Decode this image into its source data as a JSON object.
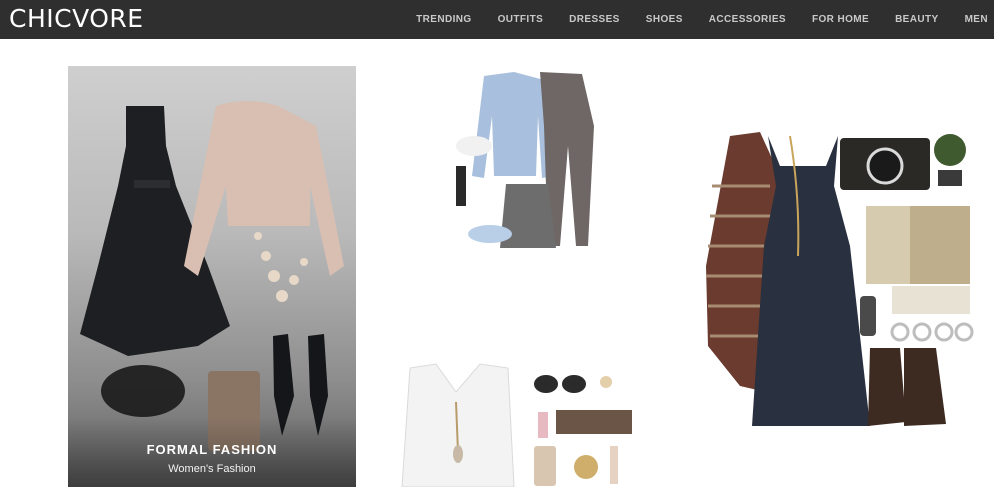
{
  "header": {
    "logo": "CHICVORE",
    "nav": [
      "TRENDING",
      "OUTFITS",
      "DRESSES",
      "SHOES",
      "ACCESSORIES",
      "FOR HOME",
      "BEAUTY",
      "MEN"
    ]
  },
  "cards": [
    {
      "title": "FORMAL FASHION",
      "subtitle": "Women's Fashion"
    }
  ],
  "colors": {
    "header_bg": "#2f2f2f",
    "header_text": "#c9c9c9"
  }
}
